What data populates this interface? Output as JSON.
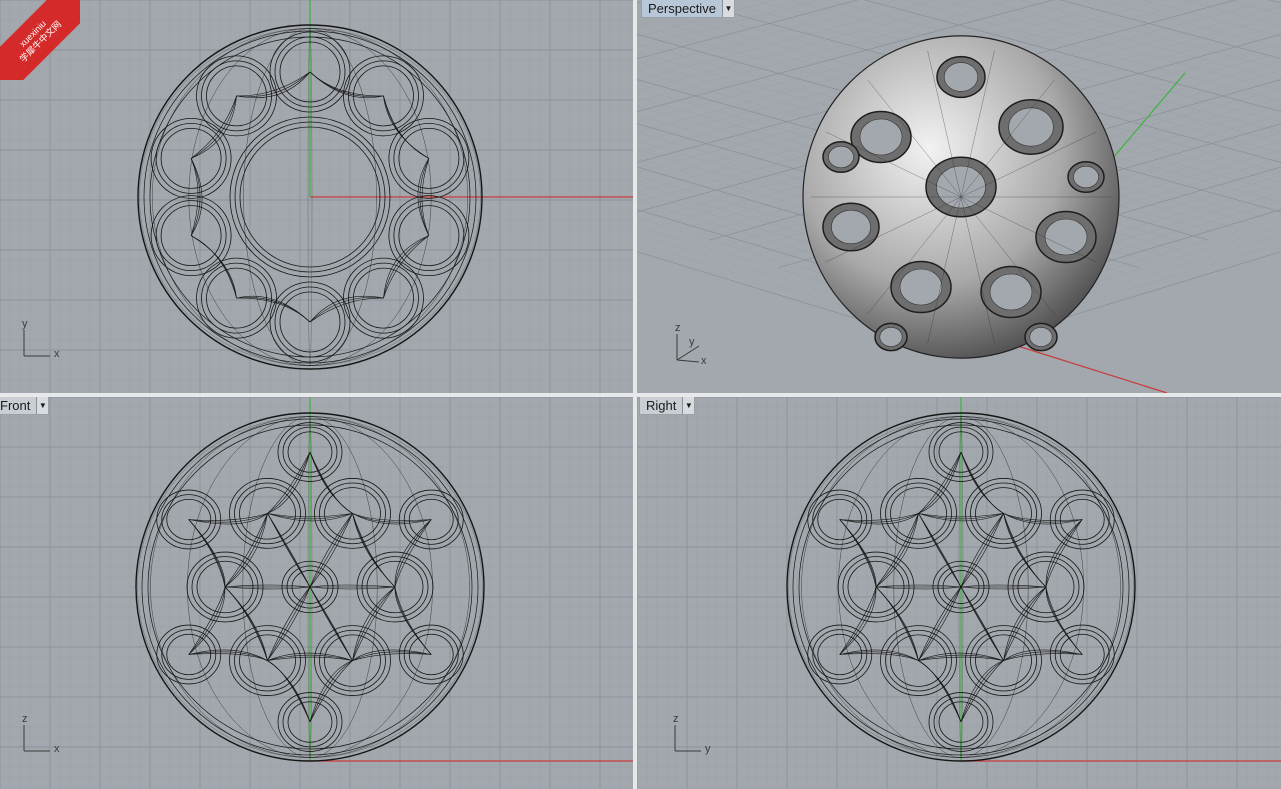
{
  "viewports": {
    "top": {
      "axes": {
        "v": "y",
        "h": "x"
      }
    },
    "perspective": {
      "label": "Perspective",
      "axes": {
        "z": "z",
        "y": "y",
        "x": "x"
      }
    },
    "front": {
      "label": "Front",
      "axes": {
        "v": "z",
        "h": "x"
      }
    },
    "right": {
      "label": "Right",
      "axes": {
        "v": "z",
        "h": "y"
      }
    }
  },
  "watermark": {
    "line1": "xuexiniu",
    "line2": "学犀牛中文网"
  },
  "colors": {
    "viewport_bg": "#a3a8ae",
    "grid_minor": "#98a0a7",
    "grid_major": "#8a9299",
    "x_axis": "#c83c3c",
    "y_axis": "#3cb43c",
    "wire": "#151515"
  }
}
